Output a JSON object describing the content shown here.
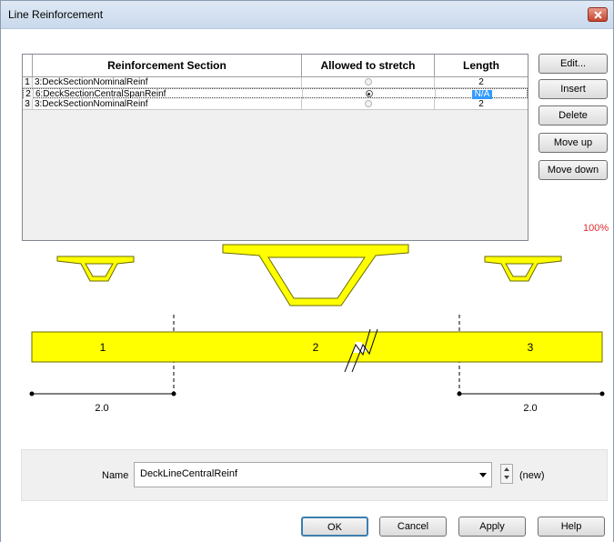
{
  "window": {
    "title": "Line Reinforcement"
  },
  "table": {
    "headers": [
      "Reinforcement Section",
      "Allowed to stretch",
      "Length"
    ],
    "rows": [
      {
        "index": "1",
        "section": "3:DeckSectionNominalReinf",
        "stretch": false,
        "length": "2"
      },
      {
        "index": "2",
        "section": "6:DeckSectionCentralSpanReinf",
        "stretch": true,
        "length": "N/A"
      },
      {
        "index": "3",
        "section": "3:DeckSectionNominalReinf",
        "stretch": false,
        "length": "2"
      }
    ]
  },
  "side_buttons": {
    "edit": "Edit...",
    "insert": "Insert",
    "delete": "Delete",
    "move_up": "Move up",
    "move_down": "Move down"
  },
  "zoom": "100%",
  "diagram": {
    "segments": [
      "1",
      "2",
      "3"
    ],
    "dim_left": "2.0",
    "dim_right": "2.0",
    "colors": {
      "fill": "#ffff00",
      "stroke": "#6b6b00"
    }
  },
  "name_panel": {
    "label": "Name",
    "value": "DeckLineCentralReinf",
    "status": "(new)"
  },
  "footer_buttons": {
    "ok": "OK",
    "cancel": "Cancel",
    "apply": "Apply",
    "help": "Help"
  }
}
